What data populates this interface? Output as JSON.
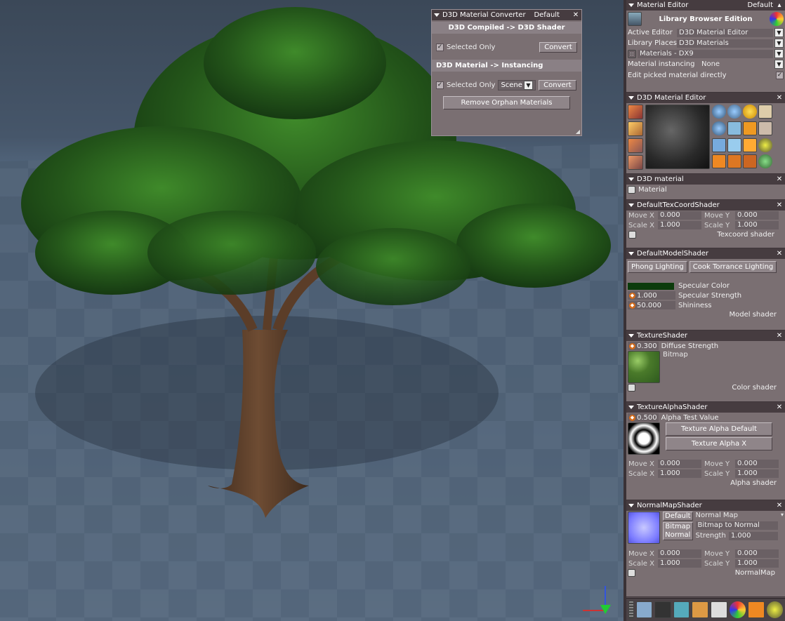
{
  "converter": {
    "title": "D3D Material Converter",
    "preset": "Default",
    "section1": "D3D Compiled -> D3D Shader",
    "selected_only": "Selected Only",
    "convert": "Convert",
    "section2": "D3D Material -> Instancing",
    "scene_option": "Scene",
    "remove_orphans": "Remove Orphan Materials"
  },
  "material_editor": {
    "title": "Material Editor",
    "preset": "Default",
    "library_edition": "Library Browser Edition",
    "active_editor_label": "Active Editor",
    "active_editor_value": "D3D Material Editor",
    "library_places_label": "Library Places",
    "library_places_value": "D3D Materials",
    "materials_value": "Materials - DX9",
    "instancing_label": "Material instancing",
    "instancing_value": "None",
    "edit_picked": "Edit picked material directly"
  },
  "d3d_editor": {
    "title": "D3D Material Editor"
  },
  "d3d_material": {
    "title": "D3D material",
    "item": "Material"
  },
  "texcoord": {
    "title": "DefaultTexCoordShader",
    "move_x_label": "Move X",
    "move_x": "0.000",
    "move_y_label": "Move Y",
    "move_y": "0.000",
    "scale_x_label": "Scale X",
    "scale_x": "1.000",
    "scale_y_label": "Scale Y",
    "scale_y": "1.000",
    "footer": "Texcoord  shader"
  },
  "model": {
    "title": "DefaultModelShader",
    "phong": "Phong Lighting",
    "cook": "Cook Torrance Lighting",
    "specular_color_label": "Specular Color",
    "specular_color": "#0b3b0b",
    "specular_strength": "1.000",
    "specular_strength_label": "Specular Strength",
    "shininess": "50.000",
    "shininess_label": "Shininess",
    "footer": "Model  shader"
  },
  "texture": {
    "title": "TextureShader",
    "diffuse_strength": "0.300",
    "diffuse_label": "Diffuse Strength",
    "bitmap_label": "Bitmap",
    "footer": "Color  shader"
  },
  "alpha": {
    "title": "TextureAlphaShader",
    "alpha_test": "0.500",
    "alpha_test_label": "Alpha Test Value",
    "btn_default": "Texture Alpha Default",
    "btn_x": "Texture Alpha X",
    "move_x_label": "Move X",
    "move_x": "0.000",
    "move_y_label": "Move Y",
    "move_y": "0.000",
    "scale_x_label": "Scale X",
    "scale_x": "1.000",
    "scale_y_label": "Scale Y",
    "scale_y": "1.000",
    "footer": "Alpha  shader"
  },
  "normal": {
    "title": "NormalMapShader",
    "btn_default": "Default",
    "normal_map_label": "Normal Map",
    "btn_bitmap": "Bitmap",
    "btn_normal": "Normal",
    "bitmap_to_normal": "Bitmap to Normal",
    "strength_label": "Strength",
    "strength": "1.000",
    "move_x_label": "Move X",
    "move_x": "0.000",
    "move_y_label": "Move Y",
    "move_y": "0.000",
    "scale_x_label": "Scale X",
    "scale_x": "1.000",
    "scale_y_label": "Scale Y",
    "scale_y": "1.000",
    "footer": "NormalMap"
  },
  "colors": {
    "panel": "#7a6f72",
    "titlebar": "#463c40",
    "accent": "#d46b1a",
    "leaf": "#2f6b1f",
    "bark": "#5b3d28"
  }
}
